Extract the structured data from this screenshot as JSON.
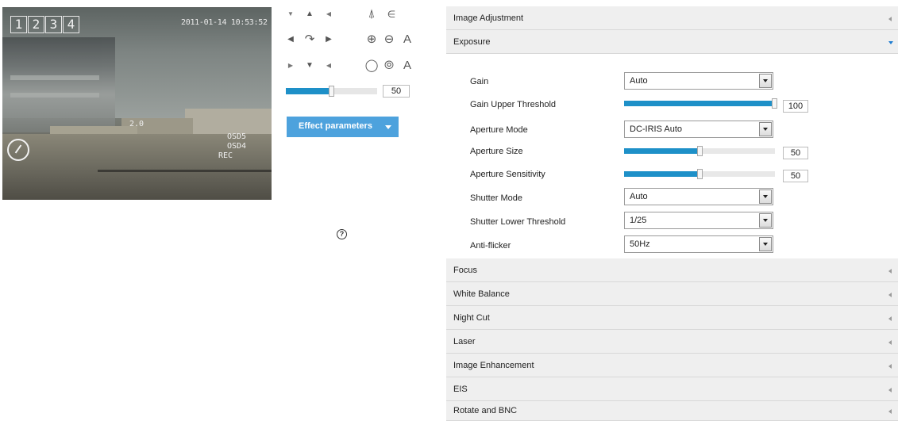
{
  "video": {
    "channel_tabs": [
      "1",
      "2",
      "3",
      "4"
    ],
    "timestamp": "2011-01-14 10:53:52",
    "zoom_readout": "2.0",
    "osd_lines": [
      "OSD5",
      "OSD4",
      "REC"
    ]
  },
  "ptz": {
    "icons": [
      "arrow-upleft-icon",
      "arrow-up-icon",
      "arrow-upright-icon",
      "arrow-left-icon",
      "rotate-icon",
      "arrow-right-icon",
      "arrow-downleft-icon",
      "arrow-down-icon",
      "arrow-downright-icon",
      "wiper-icon",
      "light-icon",
      "zoom-in-icon",
      "zoom-out-icon",
      "focus-auto-icon",
      "iris-open-icon",
      "iris-close-icon",
      "iris-auto-icon"
    ],
    "speed_value": "50",
    "speed_fraction": 0.5,
    "a_label_1": "A",
    "a_label_2": "A"
  },
  "effect_button": {
    "label": "Effect parameters"
  },
  "sections": {
    "image_adjustment": "Image Adjustment",
    "exposure": "Exposure",
    "focus": "Focus",
    "white_balance": "White Balance",
    "night_cut": "Night Cut",
    "laser": "Laser",
    "image_enhancement": "Image Enhancement",
    "eis": "EIS",
    "rotate_bnc": "Rotate and BNC"
  },
  "exposure": {
    "gain": {
      "label": "Gain",
      "value": "Auto"
    },
    "gain_upper": {
      "label": "Gain Upper Threshold",
      "value": "100",
      "fraction": 1.0
    },
    "aperture_mode": {
      "label": "Aperture Mode",
      "value": "DC-IRIS Auto"
    },
    "aperture_size": {
      "label": "Aperture Size",
      "value": "50",
      "fraction": 0.5
    },
    "aperture_sensitivity": {
      "label": "Aperture Sensitivity",
      "value": "50",
      "fraction": 0.5
    },
    "shutter_mode": {
      "label": "Shutter Mode",
      "value": "Auto"
    },
    "shutter_lower": {
      "label": "Shutter Lower Threshold",
      "value": "1/25"
    },
    "anti_flicker": {
      "label": "Anti-flicker",
      "value": "50Hz"
    },
    "help_glyph": "?"
  },
  "colors": {
    "accent": "#1e90c8",
    "button": "#4da2dd",
    "section_bg": "#efefef"
  }
}
